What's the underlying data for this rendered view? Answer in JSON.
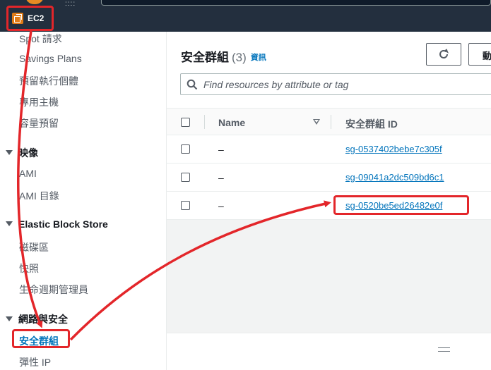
{
  "header": {
    "service_label": "EC2",
    "dots": "::::"
  },
  "sidebar": {
    "items": [
      {
        "label": "Spot 請求",
        "type": "item"
      },
      {
        "label": "Savings Plans",
        "type": "item"
      },
      {
        "label": "預留執行個體",
        "type": "item"
      },
      {
        "label": "專用主機",
        "type": "item"
      },
      {
        "label": "容量預留",
        "type": "item"
      },
      {
        "label": "映像",
        "type": "section"
      },
      {
        "label": "AMI",
        "type": "item"
      },
      {
        "label": "AMI 目錄",
        "type": "item"
      },
      {
        "label": "Elastic Block Store",
        "type": "section"
      },
      {
        "label": "磁碟區",
        "type": "item"
      },
      {
        "label": "快照",
        "type": "item"
      },
      {
        "label": "生命週期管理員",
        "type": "item"
      },
      {
        "label": "網路與安全",
        "type": "section"
      },
      {
        "label": "安全群組",
        "type": "item",
        "active": true
      },
      {
        "label": "彈性 IP",
        "type": "item"
      }
    ]
  },
  "main": {
    "title": "安全群組",
    "count": "(3)",
    "info_link": "資訊",
    "action_label": "動",
    "search_placeholder": "Find resources by attribute or tag",
    "columns": {
      "name": "Name",
      "id": "安全群組 ID"
    },
    "rows": [
      {
        "name": "–",
        "id": "sg-0537402bebe7c305f"
      },
      {
        "name": "–",
        "id": "sg-09041a2dc509bd6c1"
      },
      {
        "name": "–",
        "id": "sg-0520be5ed26482e0f"
      }
    ]
  },
  "colors": {
    "accent": "#0073bb",
    "annotation": "#e3262a",
    "header_bg": "#232f3e",
    "ec2_orange": "#e07b16"
  }
}
